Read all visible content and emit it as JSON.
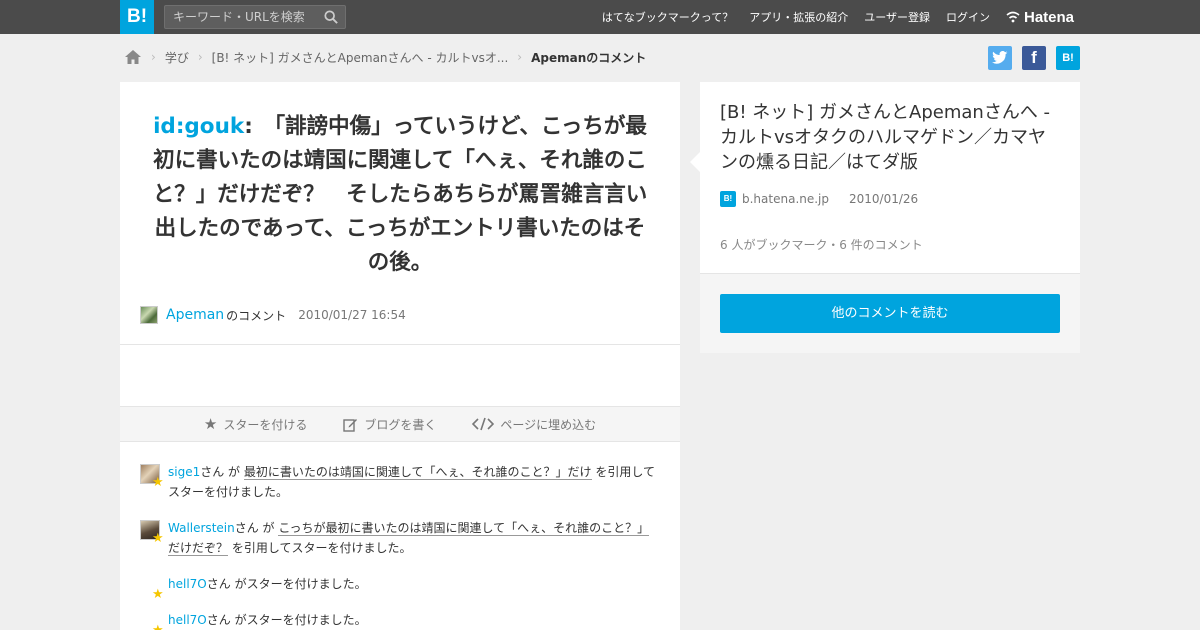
{
  "header": {
    "logo_text": "B!",
    "search_placeholder": "キーワード・URLを検索",
    "nav": [
      {
        "label": "はてなブックマークって？"
      },
      {
        "label": "アプリ・拡張の紹介"
      },
      {
        "label": "ユーザー登録"
      },
      {
        "label": "ログイン"
      }
    ],
    "hatena_label": "Hatena"
  },
  "breadcrumb": {
    "items": [
      "学び",
      "[B! ネット] ガメさんとApemanさんへ - カルトvsオ..."
    ],
    "current": "Apemanのコメント"
  },
  "share": {
    "hatena_label": "B!"
  },
  "comment": {
    "quoted_user": "id:gouk",
    "colon": ":",
    "text": "「誹謗中傷」っていうけど、こっちが最初に書いたのは靖国に関連して「へぇ、それ誰のこと？」だけだぞ？　そしたらあちらが罵詈雑言言い出したのであって、こっちがエントリ書いたのはその後。",
    "author": "Apeman",
    "author_suffix": "のコメント",
    "date": "2010/01/27 16:54"
  },
  "actions": {
    "star": "スターを付ける",
    "blog": "ブログを書く",
    "embed": "ページに埋め込む"
  },
  "stars": [
    {
      "user": "sige1",
      "pre": "さん が ",
      "quote": "最初に書いたのは靖国に関連して「へぇ、それ誰のこと？」だけ",
      "post": " を引用してスターを付けました。"
    },
    {
      "user": "Wallerstein",
      "pre": "さん が ",
      "quote": "こっちが最初に書いたのは靖国に関連して「へぇ、それ誰のこと？」だけだぞ？",
      "post": " を引用してスターを付けました。"
    },
    {
      "user": "hell7O",
      "pre": "さん がスターを付けました。"
    },
    {
      "user": "hell7O",
      "pre": "さん がスターを付けました。"
    }
  ],
  "entry": {
    "title": "[B! ネット] ガメさんとApemanさんへ - カルトvsオタクのハルマゲドン／カマヤンの燻る日記／はてダ版",
    "source_icon": "B!",
    "source": "b.hatena.ne.jp",
    "date": "2010/01/26",
    "counts": "6 人がブックマーク・6 件のコメント",
    "read_more": "他のコメントを読む"
  },
  "colors": {
    "accent": "#00a4de",
    "topbar": "#4b4b4b",
    "background": "#efefef",
    "star": "#f5c600"
  }
}
